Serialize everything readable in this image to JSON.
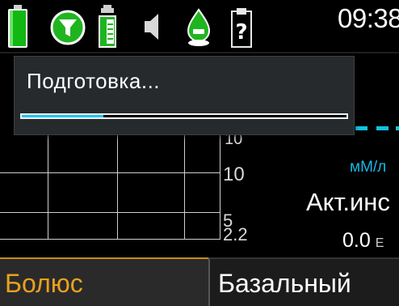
{
  "status_bar": {
    "icons": [
      "battery-icon",
      "alarm-filter-icon",
      "reservoir-icon",
      "sound-muted-icon",
      "sensor-icon",
      "help-clipboard-icon"
    ],
    "time": "09:38"
  },
  "graph": {
    "y_labels": [
      "10",
      "10",
      "5",
      "2.2"
    ],
    "unit": "мМ/л",
    "active_insulin": {
      "label": "Акт.инс",
      "value": "0.0",
      "unit": "Е"
    },
    "target_line_color": "#12c3df"
  },
  "dialog": {
    "title": "Подготовка...",
    "progress_fraction": 0.25,
    "progress_color": "#1ec6f0"
  },
  "tabs": [
    {
      "label": "Болюс",
      "active": true,
      "color": "#e8a11f"
    },
    {
      "label": "Базальный",
      "active": false
    }
  ]
}
